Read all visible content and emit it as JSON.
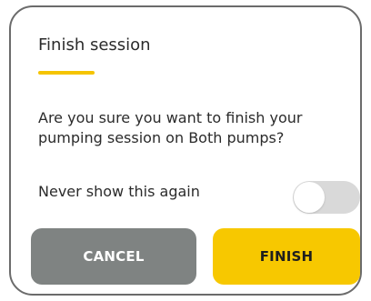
{
  "dialog": {
    "title": "Finish session",
    "message": "Are you sure you want to finish your pumping session on Both pumps?",
    "toggle": {
      "label": "Never show this again",
      "checked": false
    },
    "buttons": {
      "cancel": "CANCEL",
      "finish": "FINISH"
    }
  },
  "colors": {
    "accent": "#f5c400",
    "finish_button": "#f7c800",
    "cancel_button": "#7f8382",
    "toggle_track_off": "#d9d9d9",
    "border": "#6b6b6b"
  }
}
